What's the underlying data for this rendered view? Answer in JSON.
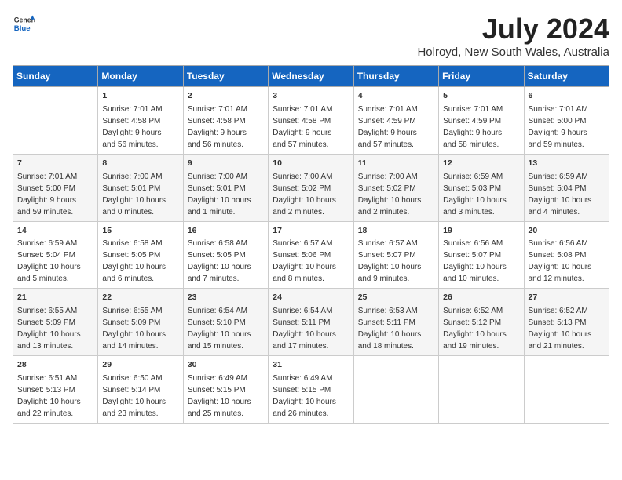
{
  "header": {
    "logo_line1": "General",
    "logo_line2": "Blue",
    "title": "July 2024",
    "subtitle": "Holroyd, New South Wales, Australia"
  },
  "days_of_week": [
    "Sunday",
    "Monday",
    "Tuesday",
    "Wednesday",
    "Thursday",
    "Friday",
    "Saturday"
  ],
  "weeks": [
    [
      {
        "day": "",
        "content": ""
      },
      {
        "day": "1",
        "content": "Sunrise: 7:01 AM\nSunset: 4:58 PM\nDaylight: 9 hours\nand 56 minutes."
      },
      {
        "day": "2",
        "content": "Sunrise: 7:01 AM\nSunset: 4:58 PM\nDaylight: 9 hours\nand 56 minutes."
      },
      {
        "day": "3",
        "content": "Sunrise: 7:01 AM\nSunset: 4:58 PM\nDaylight: 9 hours\nand 57 minutes."
      },
      {
        "day": "4",
        "content": "Sunrise: 7:01 AM\nSunset: 4:59 PM\nDaylight: 9 hours\nand 57 minutes."
      },
      {
        "day": "5",
        "content": "Sunrise: 7:01 AM\nSunset: 4:59 PM\nDaylight: 9 hours\nand 58 minutes."
      },
      {
        "day": "6",
        "content": "Sunrise: 7:01 AM\nSunset: 5:00 PM\nDaylight: 9 hours\nand 59 minutes."
      }
    ],
    [
      {
        "day": "7",
        "content": "Sunrise: 7:01 AM\nSunset: 5:00 PM\nDaylight: 9 hours\nand 59 minutes."
      },
      {
        "day": "8",
        "content": "Sunrise: 7:00 AM\nSunset: 5:01 PM\nDaylight: 10 hours\nand 0 minutes."
      },
      {
        "day": "9",
        "content": "Sunrise: 7:00 AM\nSunset: 5:01 PM\nDaylight: 10 hours\nand 1 minute."
      },
      {
        "day": "10",
        "content": "Sunrise: 7:00 AM\nSunset: 5:02 PM\nDaylight: 10 hours\nand 2 minutes."
      },
      {
        "day": "11",
        "content": "Sunrise: 7:00 AM\nSunset: 5:02 PM\nDaylight: 10 hours\nand 2 minutes."
      },
      {
        "day": "12",
        "content": "Sunrise: 6:59 AM\nSunset: 5:03 PM\nDaylight: 10 hours\nand 3 minutes."
      },
      {
        "day": "13",
        "content": "Sunrise: 6:59 AM\nSunset: 5:04 PM\nDaylight: 10 hours\nand 4 minutes."
      }
    ],
    [
      {
        "day": "14",
        "content": "Sunrise: 6:59 AM\nSunset: 5:04 PM\nDaylight: 10 hours\nand 5 minutes."
      },
      {
        "day": "15",
        "content": "Sunrise: 6:58 AM\nSunset: 5:05 PM\nDaylight: 10 hours\nand 6 minutes."
      },
      {
        "day": "16",
        "content": "Sunrise: 6:58 AM\nSunset: 5:05 PM\nDaylight: 10 hours\nand 7 minutes."
      },
      {
        "day": "17",
        "content": "Sunrise: 6:57 AM\nSunset: 5:06 PM\nDaylight: 10 hours\nand 8 minutes."
      },
      {
        "day": "18",
        "content": "Sunrise: 6:57 AM\nSunset: 5:07 PM\nDaylight: 10 hours\nand 9 minutes."
      },
      {
        "day": "19",
        "content": "Sunrise: 6:56 AM\nSunset: 5:07 PM\nDaylight: 10 hours\nand 10 minutes."
      },
      {
        "day": "20",
        "content": "Sunrise: 6:56 AM\nSunset: 5:08 PM\nDaylight: 10 hours\nand 12 minutes."
      }
    ],
    [
      {
        "day": "21",
        "content": "Sunrise: 6:55 AM\nSunset: 5:09 PM\nDaylight: 10 hours\nand 13 minutes."
      },
      {
        "day": "22",
        "content": "Sunrise: 6:55 AM\nSunset: 5:09 PM\nDaylight: 10 hours\nand 14 minutes."
      },
      {
        "day": "23",
        "content": "Sunrise: 6:54 AM\nSunset: 5:10 PM\nDaylight: 10 hours\nand 15 minutes."
      },
      {
        "day": "24",
        "content": "Sunrise: 6:54 AM\nSunset: 5:11 PM\nDaylight: 10 hours\nand 17 minutes."
      },
      {
        "day": "25",
        "content": "Sunrise: 6:53 AM\nSunset: 5:11 PM\nDaylight: 10 hours\nand 18 minutes."
      },
      {
        "day": "26",
        "content": "Sunrise: 6:52 AM\nSunset: 5:12 PM\nDaylight: 10 hours\nand 19 minutes."
      },
      {
        "day": "27",
        "content": "Sunrise: 6:52 AM\nSunset: 5:13 PM\nDaylight: 10 hours\nand 21 minutes."
      }
    ],
    [
      {
        "day": "28",
        "content": "Sunrise: 6:51 AM\nSunset: 5:13 PM\nDaylight: 10 hours\nand 22 minutes."
      },
      {
        "day": "29",
        "content": "Sunrise: 6:50 AM\nSunset: 5:14 PM\nDaylight: 10 hours\nand 23 minutes."
      },
      {
        "day": "30",
        "content": "Sunrise: 6:49 AM\nSunset: 5:15 PM\nDaylight: 10 hours\nand 25 minutes."
      },
      {
        "day": "31",
        "content": "Sunrise: 6:49 AM\nSunset: 5:15 PM\nDaylight: 10 hours\nand 26 minutes."
      },
      {
        "day": "",
        "content": ""
      },
      {
        "day": "",
        "content": ""
      },
      {
        "day": "",
        "content": ""
      }
    ]
  ]
}
